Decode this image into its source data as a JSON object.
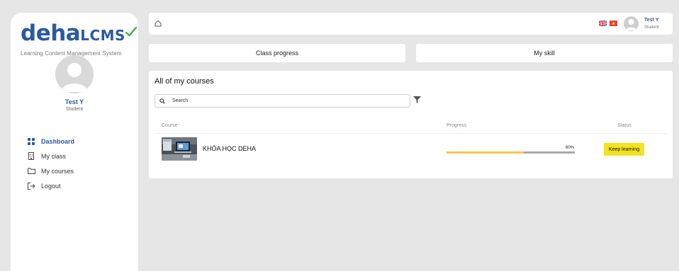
{
  "brand": {
    "logo_text_1": "deha",
    "logo_text_2": "LCMS",
    "tagline": "Learning Content Management System",
    "primary_color": "#2a5aa0",
    "check_color": "#4caf50"
  },
  "user": {
    "name": "Test Y",
    "role": "Student"
  },
  "sidebar": {
    "items": [
      {
        "label": "Dashboard",
        "icon": "grid-icon",
        "active": true
      },
      {
        "label": "My class",
        "icon": "building-icon",
        "active": false
      },
      {
        "label": "My courses",
        "icon": "folder-icon",
        "active": false
      },
      {
        "label": "Logout",
        "icon": "logout-icon",
        "active": false
      }
    ]
  },
  "header": {
    "home_icon": "home-icon",
    "languages": [
      "en",
      "vi"
    ]
  },
  "tabs": [
    {
      "label": "Class progress"
    },
    {
      "label": "My skill"
    }
  ],
  "courses_card": {
    "title": "All of my courses",
    "search_placeholder": "Search",
    "columns": [
      "Course",
      "Progress",
      "Status"
    ],
    "rows": [
      {
        "name": "KHÓA HỌC DEHA",
        "progress": 60,
        "progress_label": "60%",
        "status": "Keep learning"
      }
    ],
    "progress_color": "#f2c94c",
    "status_color": "#f3e21f"
  }
}
